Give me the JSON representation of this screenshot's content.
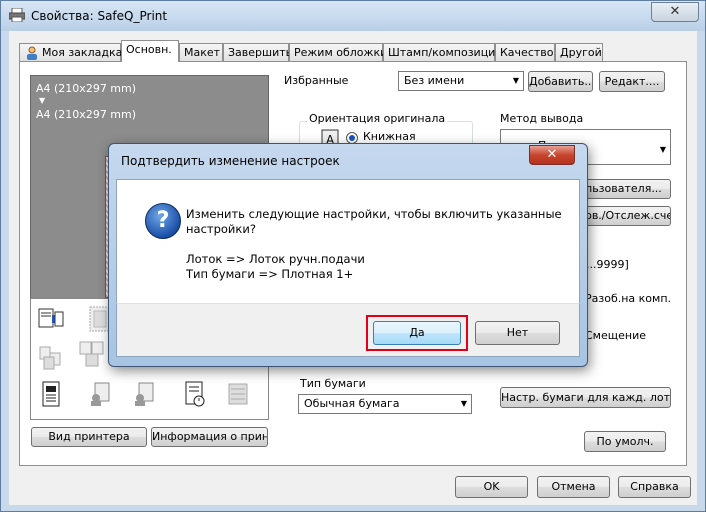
{
  "window": {
    "title": "Свойства: SafeQ_Print",
    "close_glyph": "✕",
    "icon": "printer-icon"
  },
  "tabs": [
    {
      "label": "Моя закладка",
      "active": false
    },
    {
      "label": "Основн.",
      "active": true
    },
    {
      "label": "Макет",
      "active": false
    },
    {
      "label": "Завершить",
      "active": false
    },
    {
      "label": "Режим обложки",
      "active": false
    },
    {
      "label": "Штамп/композиция",
      "active": false
    },
    {
      "label": "Качество",
      "active": false
    },
    {
      "label": "Другой",
      "active": false
    }
  ],
  "preview": {
    "paper_from": "A4 (210x297 mm)",
    "arrow": "▼",
    "paper_to": "A4 (210x297 mm)"
  },
  "left_buttons": {
    "printer_view": "Вид принтера",
    "printer_info": "Информация о принт."
  },
  "favorites": {
    "label": "Избранные",
    "value": "Без имени",
    "add": "Добавить...",
    "edit": "Редакт...."
  },
  "orientation": {
    "label": "Ориентация оригинала",
    "option_portrait": "Книжная"
  },
  "output": {
    "label": "Метод вывода",
    "value": "Печать",
    "user_btn": "Пользователя...",
    "account_btn": "Авт.пров./Отслеж.счета"
  },
  "copies": {
    "range": "1...9999]"
  },
  "options": {
    "collate": "Разоб.на комп.",
    "offset": "Смещение"
  },
  "paper_type": {
    "label": "Тип бумаги",
    "value": "Обычная бумага",
    "per_tray_btn": "Настр. бумаги для кажд. лотка..."
  },
  "defaults_btn": "По умолч.",
  "footer": {
    "ok": "OK",
    "cancel": "Отмена",
    "help": "Справка"
  },
  "dialog": {
    "title": "Подтвердить изменение настроек",
    "close_glyph": "✕",
    "icon_glyph": "?",
    "message_line1": "Изменить следующие настройки, чтобы включить указанные",
    "message_line2": "настройки?",
    "change_line1": "Лоток => Лоток ручн.подачи",
    "change_line2": "Тип бумаги => Плотная 1+",
    "yes": "Да",
    "no": "Нет"
  },
  "colors": {
    "highlight": "#e0001a",
    "dialog_close": "#c7452f"
  }
}
